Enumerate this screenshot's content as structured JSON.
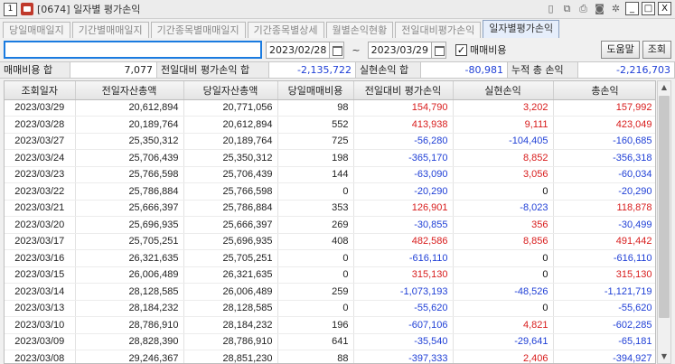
{
  "window": {
    "title": "[0674] 일자별 평가손익",
    "badge": "1",
    "close_label": "X",
    "min_label": "_",
    "max_label": "□"
  },
  "tabs": [
    {
      "label": "당일매매일지",
      "active": false
    },
    {
      "label": "기간별매매일지",
      "active": false
    },
    {
      "label": "기간종목별매매일지",
      "active": false
    },
    {
      "label": "기간종목별상세",
      "active": false
    },
    {
      "label": "월별손익현황",
      "active": false
    },
    {
      "label": "전일대비평가손익",
      "active": false
    },
    {
      "label": "일자별평가손익",
      "active": true
    }
  ],
  "toolbar": {
    "start_date": "2023/02/28",
    "end_date": "2023/03/29",
    "tilde": "~",
    "checkbox_label": "매매비용",
    "checkbox_mark": "✓",
    "help_label": "도움말",
    "query_label": "조회"
  },
  "summary": {
    "fee_label": "매매비용 합",
    "fee_value": "7,077",
    "prev_label": "전일대비 평가손익 합",
    "prev_value": "-2,135,722",
    "realized_label": "실현손익 합",
    "realized_value": "-80,981",
    "cum_label": "누적 총 손익",
    "cum_value": "-2,216,703"
  },
  "table": {
    "headers": [
      "조회일자",
      "전일자산총액",
      "당일자산총액",
      "당일매매비용",
      "전일대비 평가손익",
      "실현손익",
      "총손익"
    ],
    "rows": [
      [
        "2023/03/29",
        "20,612,894",
        "20,771,056",
        "98",
        "154,790",
        "3,202",
        "157,992"
      ],
      [
        "2023/03/28",
        "20,189,764",
        "20,612,894",
        "552",
        "413,938",
        "9,111",
        "423,049"
      ],
      [
        "2023/03/27",
        "25,350,312",
        "20,189,764",
        "725",
        "-56,280",
        "-104,405",
        "-160,685"
      ],
      [
        "2023/03/24",
        "25,706,439",
        "25,350,312",
        "198",
        "-365,170",
        "8,852",
        "-356,318"
      ],
      [
        "2023/03/23",
        "25,766,598",
        "25,706,439",
        "144",
        "-63,090",
        "3,056",
        "-60,034"
      ],
      [
        "2023/03/22",
        "25,786,884",
        "25,766,598",
        "0",
        "-20,290",
        "0",
        "-20,290"
      ],
      [
        "2023/03/21",
        "25,666,397",
        "25,786,884",
        "353",
        "126,901",
        "-8,023",
        "118,878"
      ],
      [
        "2023/03/20",
        "25,696,935",
        "25,666,397",
        "269",
        "-30,855",
        "356",
        "-30,499"
      ],
      [
        "2023/03/17",
        "25,705,251",
        "25,696,935",
        "408",
        "482,586",
        "8,856",
        "491,442"
      ],
      [
        "2023/03/16",
        "26,321,635",
        "25,705,251",
        "0",
        "-616,110",
        "0",
        "-616,110"
      ],
      [
        "2023/03/15",
        "26,006,489",
        "26,321,635",
        "0",
        "315,130",
        "0",
        "315,130"
      ],
      [
        "2023/03/14",
        "28,128,585",
        "26,006,489",
        "259",
        "-1,073,193",
        "-48,526",
        "-1,121,719"
      ],
      [
        "2023/03/13",
        "28,184,232",
        "28,128,585",
        "0",
        "-55,620",
        "0",
        "-55,620"
      ],
      [
        "2023/03/10",
        "28,786,910",
        "28,184,232",
        "196",
        "-607,106",
        "4,821",
        "-602,285"
      ],
      [
        "2023/03/09",
        "28,828,390",
        "28,786,910",
        "641",
        "-35,540",
        "-29,641",
        "-65,181"
      ],
      [
        "2023/03/08",
        "29,246,367",
        "28,851,230",
        "88",
        "-397,333",
        "2,406",
        "-394,927"
      ]
    ]
  },
  "colors": {
    "positive": "#d81c1c",
    "negative": "#1f3fd6",
    "accent": "#1a7be0"
  }
}
